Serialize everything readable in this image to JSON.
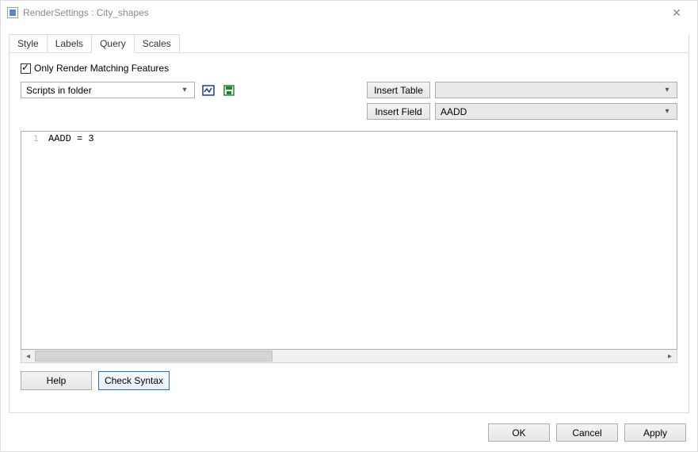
{
  "titlebar": {
    "title": "RenderSettings : City_shapes"
  },
  "tabs": [
    {
      "label": "Style",
      "active": false
    },
    {
      "label": "Labels",
      "active": false
    },
    {
      "label": "Query",
      "active": true
    },
    {
      "label": "Scales",
      "active": false
    }
  ],
  "checkbox": {
    "label": "Only Render Matching Features",
    "checked": true
  },
  "scripts_dropdown": {
    "label": "Scripts in folder"
  },
  "insert_table": {
    "button": "Insert Table",
    "value": ""
  },
  "insert_field": {
    "button": "Insert Field",
    "value": "AADD"
  },
  "editor": {
    "line_number": "1",
    "code": "AADD = 3"
  },
  "buttons": {
    "help": "Help",
    "check_syntax": "Check Syntax",
    "ok": "OK",
    "cancel": "Cancel",
    "apply": "Apply"
  }
}
